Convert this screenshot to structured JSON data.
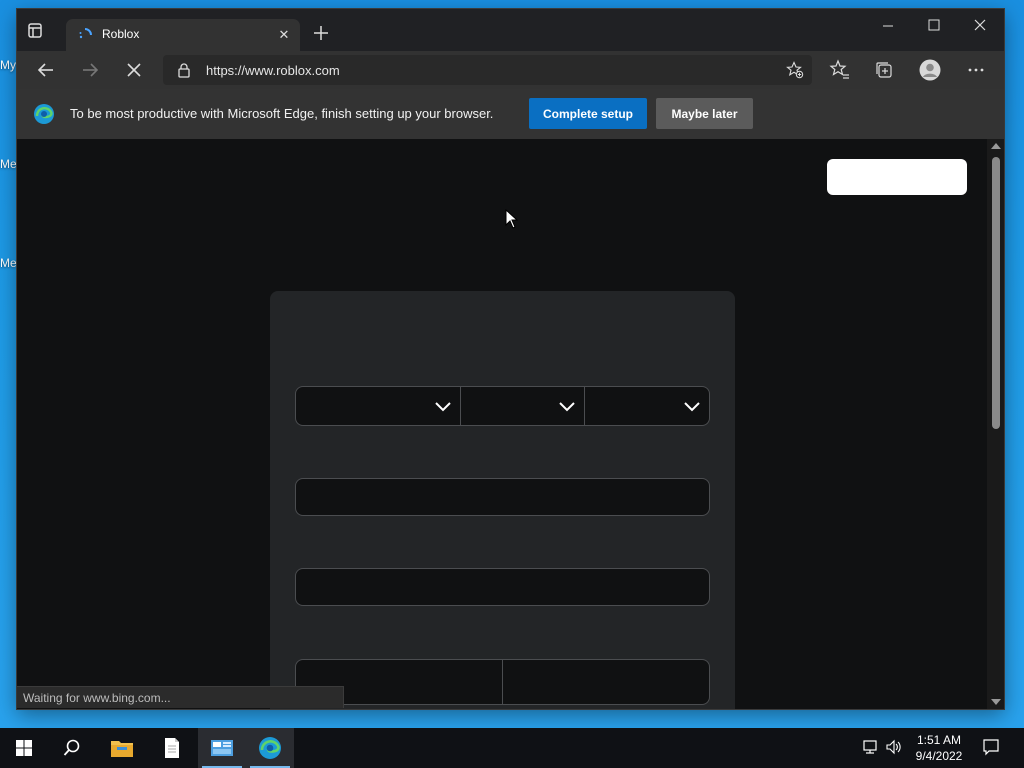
{
  "desktop": {
    "labels": [
      "My",
      "Me",
      "Me"
    ]
  },
  "browser": {
    "tab": {
      "title": "Roblox"
    },
    "address": {
      "url": "https://www.roblox.com"
    },
    "infobar": {
      "message": "To be most productive with Microsoft Edge, finish setting up your browser.",
      "primary_label": "Complete setup",
      "secondary_label": "Maybe later"
    },
    "status_text": "Waiting for www.bing.com..."
  },
  "colors": {
    "accent": "#0a6fc2",
    "page_bg": "#101112",
    "card_bg": "#232527",
    "field_border": "#4b4d50"
  },
  "taskbar": {
    "items": [
      "start-icon",
      "search-icon",
      "file-explorer-icon",
      "notepad-icon",
      "control-panel-icon",
      "edge-icon"
    ],
    "clock": {
      "time": "1:51 AM",
      "date": "9/4/2022"
    }
  }
}
